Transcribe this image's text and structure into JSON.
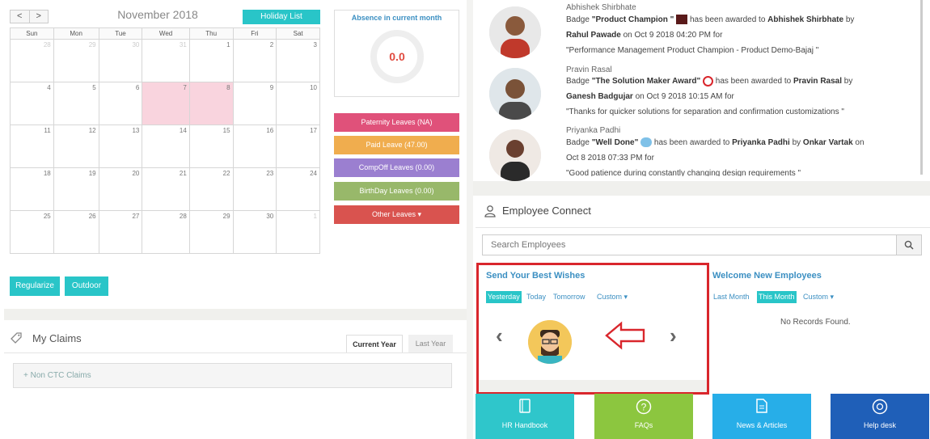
{
  "calendar": {
    "prev": "<",
    "next": ">",
    "month": "November 2018",
    "holiday_btn": "Holiday List",
    "weekdays": [
      "Sun",
      "Mon",
      "Tue",
      "Wed",
      "Thu",
      "Fri",
      "Sat"
    ],
    "weeks": [
      [
        "28",
        "29",
        "30",
        "31",
        "1",
        "2",
        "3"
      ],
      [
        "4",
        "5",
        "6",
        "7",
        "8",
        "9",
        "10"
      ],
      [
        "11",
        "12",
        "13",
        "14",
        "15",
        "16",
        "17"
      ],
      [
        "18",
        "19",
        "20",
        "21",
        "22",
        "23",
        "24"
      ],
      [
        "25",
        "26",
        "27",
        "28",
        "29",
        "30",
        "1"
      ]
    ]
  },
  "absence": {
    "title": "Absence in current month",
    "value": "0.0"
  },
  "leaves": {
    "paternity": "Paternity Leaves (NA)",
    "paid": "Paid Leave (47.00)",
    "compoff": "CompOff Leaves (0.00)",
    "birthday": "BirthDay Leaves (0.00)",
    "other": "Other Leaves ▾"
  },
  "actions": {
    "regularize": "Regularize",
    "outdoor": "Outdoor"
  },
  "claims": {
    "title": "My Claims",
    "tab_current": "Current Year",
    "tab_last": "Last Year",
    "row": "+ Non CTC Claims"
  },
  "badges": [
    {
      "name": "Abhishek Shirbhate",
      "l1a": "Badge ",
      "badge": "\"Product Champion \"",
      "l1b": " has been awarded to ",
      "to": "Abhishek Shirbhate",
      "l1c": " by",
      "by": "Rahul Pawade",
      "on": " on Oct 9 2018 04:20 PM for",
      "msg": "\"Performance Management Product Champion - Product Demo-Bajaj \""
    },
    {
      "name": "Pravin Rasal",
      "l1a": "Badge ",
      "badge": "\"The Solution Maker Award\"",
      "l1b": " has been awarded to ",
      "to": "Pravin Rasal",
      "l1c": " by",
      "by": "Ganesh Badgujar",
      "on": " on Oct 9 2018 10:15 AM for",
      "msg": "\"Thanks for quicker solutions for separation and confirmation customizations \""
    },
    {
      "name": "Priyanka Padhi",
      "l1a": "Badge ",
      "badge": "\"Well Done\"",
      "l1b": " has been awarded to ",
      "to": "Priyanka Padhi",
      "l1c": " by ",
      "by": "Onkar Vartak",
      "on": " on",
      "date2": "Oct 8 2018 07:33 PM for",
      "msg": "\"Good patience during constantly changing design requirements \""
    }
  ],
  "employee_connect": {
    "title": "Employee Connect",
    "search_placeholder": "Search Employees"
  },
  "best_wishes": {
    "title": "Send Your Best Wishes",
    "yesterday": "Yesterday",
    "today": "Today",
    "tomorrow": "Tomorrow",
    "custom": "Custom ▾",
    "prev": "‹",
    "next": "›"
  },
  "welcome": {
    "title": "Welcome New Employees",
    "last_month": "Last Month",
    "this_month": "This Month",
    "custom": "Custom ▾",
    "empty": "No Records Found."
  },
  "tiles": {
    "hr": "HR Handbook",
    "faq": "FAQs",
    "news": "News & Articles",
    "help": "Help desk"
  },
  "colors": {
    "teal": "#29c5c8",
    "paternity": "#e0517a",
    "paid": "#f0ad4e",
    "compoff": "#9b7fd0",
    "birthday": "#98b86a",
    "other": "#d9534f",
    "tile_hr": "#2fc6cb",
    "tile_faq": "#8cc63f",
    "tile_news": "#27aee8",
    "tile_help": "#1f5fb8",
    "highlight_box": "#d9262c"
  }
}
